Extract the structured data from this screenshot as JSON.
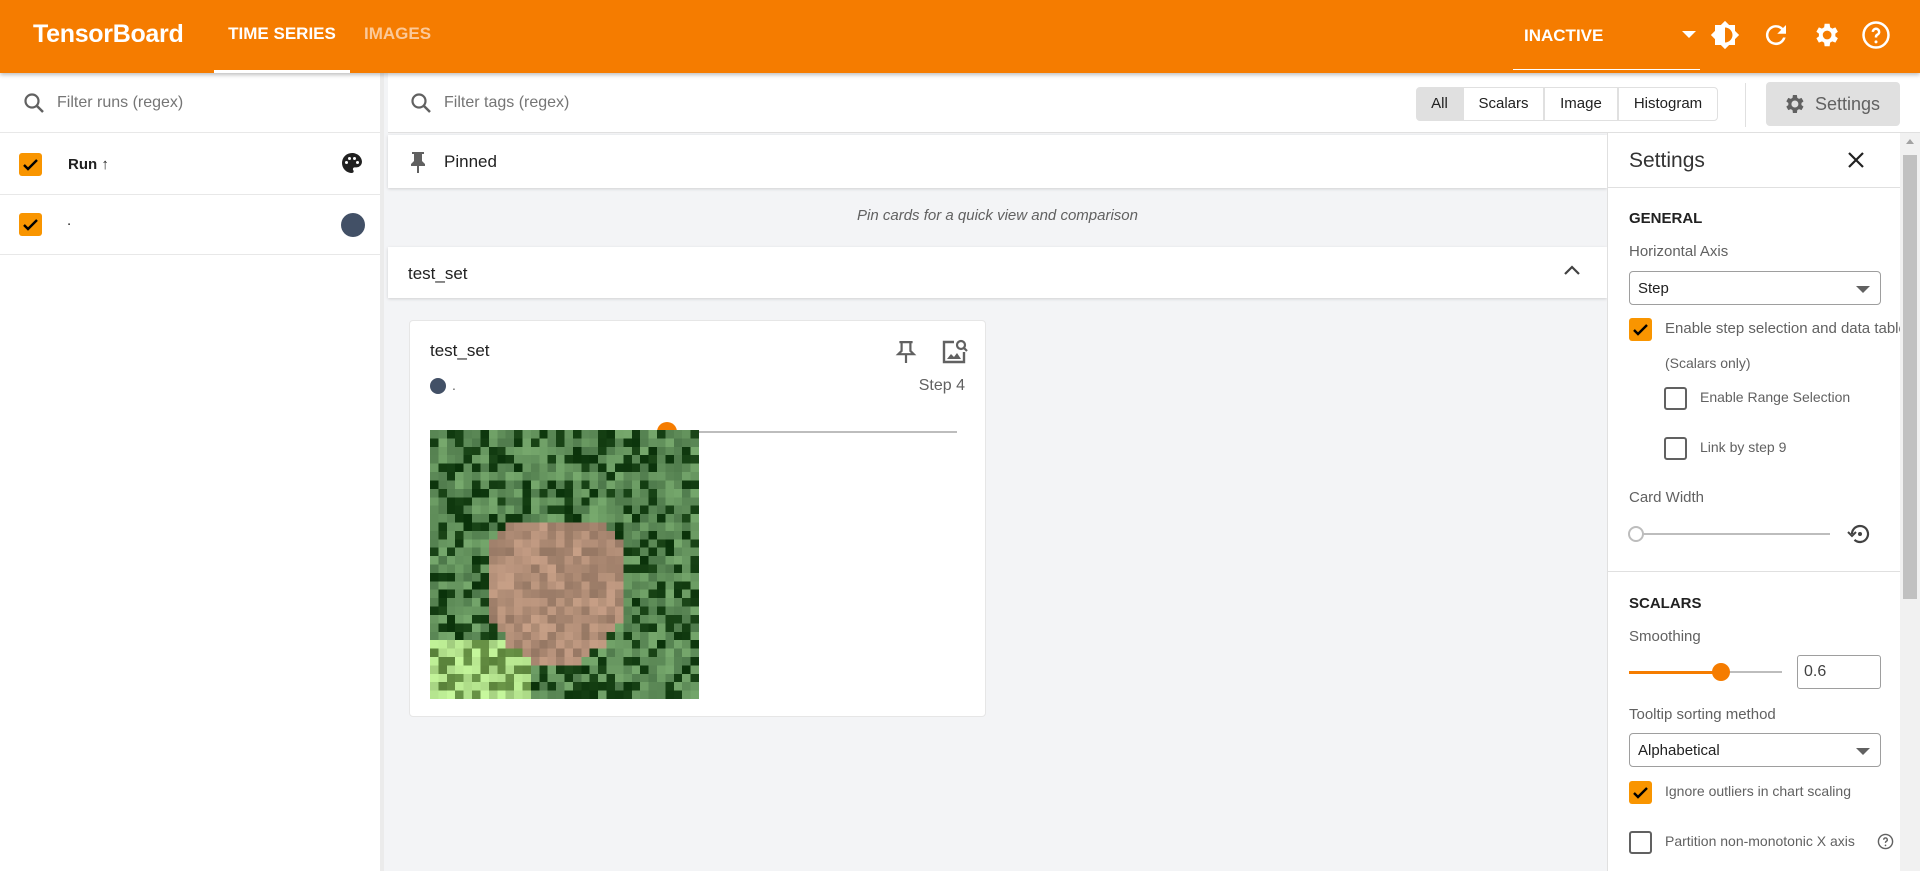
{
  "header": {
    "logo": "TensorBoard",
    "tabs": [
      {
        "label": "TIME SERIES",
        "active": true
      },
      {
        "label": "IMAGES",
        "active": false
      }
    ],
    "plugin_select": "INACTIVE",
    "icons": [
      "theme-icon",
      "reload-icon",
      "settings-icon",
      "help-icon"
    ],
    "accent": "#f57c00"
  },
  "sidebar": {
    "filter_placeholder": "Filter runs (regex)",
    "header_label": "Run ↑",
    "runs": [
      {
        "name": ".",
        "checked": true,
        "color": "#425066"
      }
    ]
  },
  "toolbar": {
    "filter_placeholder": "Filter tags (regex)",
    "types": [
      "All",
      "Scalars",
      "Image",
      "Histogram"
    ],
    "active_type": "All",
    "settings_label": "Settings"
  },
  "pinned": {
    "title": "Pinned",
    "empty_text": "Pin cards for a quick view and comparison"
  },
  "group": {
    "title": "test_set"
  },
  "card": {
    "title": "test_set",
    "run": ".",
    "step_label": "Step 4",
    "step_progress": 0.44
  },
  "settings": {
    "title": "Settings",
    "general": "GENERAL",
    "horizontal_axis_label": "Horizontal Axis",
    "horizontal_axis": "Step",
    "step_selection": "Enable step selection and data table",
    "scalars_only": "(Scalars only)",
    "range_selection": "Enable Range Selection",
    "link_by_step": "Link by step 9",
    "card_width": "Card Width",
    "card_width_value": 0,
    "scalars": "SCALARS",
    "smoothing_label": "Smoothing",
    "smoothing": "0.6",
    "tooltip_label": "Tooltip sorting method",
    "tooltip": "Alphabetical",
    "ignore_outliers": "Ignore outliers in chart scaling",
    "partition": "Partition non-monotonic X axis"
  }
}
